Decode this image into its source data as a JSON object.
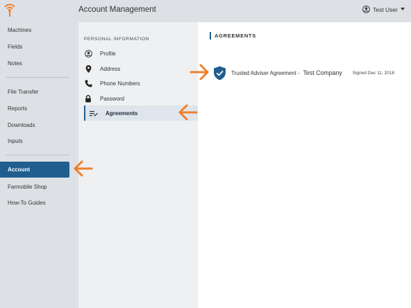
{
  "colors": {
    "accent": "#1f5e8e",
    "orange": "#f07f2a",
    "sidebar_bg": "#dde0e4",
    "submenu_bg": "#eef0f2"
  },
  "header": {
    "title": "Account Management",
    "user": {
      "name": "Test User",
      "icon": "user-circle-icon",
      "caret_icon": "caret-down-icon"
    },
    "logo_icon": "signal-antenna-logo-icon"
  },
  "sidebar": {
    "groups": [
      {
        "items": [
          {
            "label": "Machines"
          },
          {
            "label": "Fields"
          },
          {
            "label": "Notes"
          }
        ]
      },
      {
        "items": [
          {
            "label": "File Transfer"
          },
          {
            "label": "Reports"
          },
          {
            "label": "Downloads"
          },
          {
            "label": "Inputs"
          }
        ]
      },
      {
        "items": [
          {
            "label": "Account",
            "active": true
          },
          {
            "label": "Farmobile Shop"
          },
          {
            "label": "How-To Guides"
          }
        ]
      }
    ]
  },
  "submenu": {
    "section_label": "PERSONAL INFORMATION",
    "items": [
      {
        "label": "Profile",
        "icon": "user-circle-icon"
      },
      {
        "label": "Address",
        "icon": "map-pin-icon"
      },
      {
        "label": "Phone Numbers",
        "icon": "phone-icon"
      },
      {
        "label": "Password",
        "icon": "lock-icon"
      },
      {
        "label": "Agreements",
        "icon": "list-check-icon",
        "active": true
      }
    ]
  },
  "main": {
    "heading": "AGREEMENTS",
    "agreements": [
      {
        "name": "Trusted Adviser Agreement -",
        "company": "Test Company",
        "signed": "Signed Dec 11, 2018",
        "icon": "shield-check-icon"
      }
    ]
  },
  "annotations": {
    "arrow_icon": "arrow-left-icon"
  }
}
